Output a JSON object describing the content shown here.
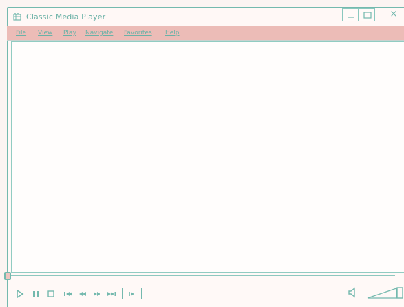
{
  "window": {
    "title": "Classic Media Player",
    "controls": {
      "minimize": "minimize",
      "maximize": "maximize",
      "close": "×"
    }
  },
  "menu": {
    "items": [
      {
        "label": "File"
      },
      {
        "label": "View"
      },
      {
        "label": "Play"
      },
      {
        "label": "Navigate"
      },
      {
        "label": "Favorites"
      },
      {
        "label": "Help"
      }
    ]
  },
  "playback": {
    "seek_position": 0.0,
    "volume_level": 1.0
  },
  "icons": {
    "app": "media-player-icon",
    "play": "play-icon",
    "pause": "pause-icon",
    "stop": "stop-icon",
    "previous": "skip-back-icon",
    "rewind": "rewind-icon",
    "fast_forward": "fast-forward-icon",
    "next": "skip-forward-icon",
    "frame_step": "frame-step-icon",
    "volume": "speaker-icon"
  },
  "colors": {
    "accent": "#74b9ae",
    "menu_background": "#ecbcb7",
    "window_background": "#fff9f7"
  }
}
